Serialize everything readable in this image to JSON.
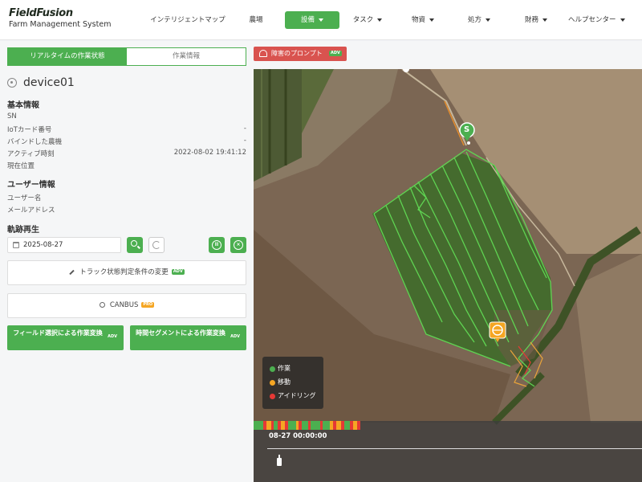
{
  "app": {
    "logo_title": "FieldFusion",
    "logo_subtitle": "Farm Management System"
  },
  "nav": {
    "items": [
      {
        "label": "インテリジェントマップ",
        "dropdown": false
      },
      {
        "label": "農場",
        "dropdown": false
      },
      {
        "label": "設備",
        "dropdown": true,
        "active": true
      },
      {
        "label": "タスク",
        "dropdown": true
      },
      {
        "label": "物資",
        "dropdown": true
      },
      {
        "label": "処方",
        "dropdown": true
      },
      {
        "label": "財務",
        "dropdown": true
      },
      {
        "label": "ヘルプセンター",
        "dropdown": true
      }
    ]
  },
  "tabs": {
    "realtime": "リアルタイムの作業状態",
    "work_info": "作業情報"
  },
  "device": {
    "name": "device01"
  },
  "basic_info": {
    "title": "基本情報",
    "rows": [
      {
        "label": "SN",
        "value": ""
      },
      {
        "label": "IoTカード番号",
        "value": "-"
      },
      {
        "label": "バインドした農機",
        "value": "-"
      },
      {
        "label": "アクティブ時刻",
        "value": "2022-08-02 19:41:12"
      },
      {
        "label": "現在位置",
        "value": ""
      }
    ]
  },
  "user_info": {
    "title": "ユーザー情報",
    "rows": [
      {
        "label": "ユーザー名",
        "value": ""
      },
      {
        "label": "メールアドレス",
        "value": ""
      }
    ]
  },
  "playback": {
    "title": "軌跡再生",
    "date": "2025-08-27",
    "pause_glyph": "II",
    "close_glyph": "×"
  },
  "buttons": {
    "track_condition": "トラック状態判定条件の変更",
    "track_condition_badge": "ADV",
    "canbus": "CANBUS",
    "canbus_badge": "PRO",
    "field_convert": "フィールド選択による作業変換",
    "field_convert_badge": "ADV",
    "time_convert": "時間セグメントによる作業変換",
    "time_convert_badge": "ADV"
  },
  "map": {
    "prompt_label": "障害のプロンプト",
    "prompt_badge": "ADV",
    "start_marker": "S",
    "legend": [
      {
        "label": "作業",
        "color": "#4caf50"
      },
      {
        "label": "移動",
        "color": "#f5a623"
      },
      {
        "label": "アイドリング",
        "color": "#e53935"
      }
    ],
    "time_label": "08-27 00:00:00"
  },
  "colors": {
    "accent": "#4caf50",
    "danger": "#d9534f"
  }
}
